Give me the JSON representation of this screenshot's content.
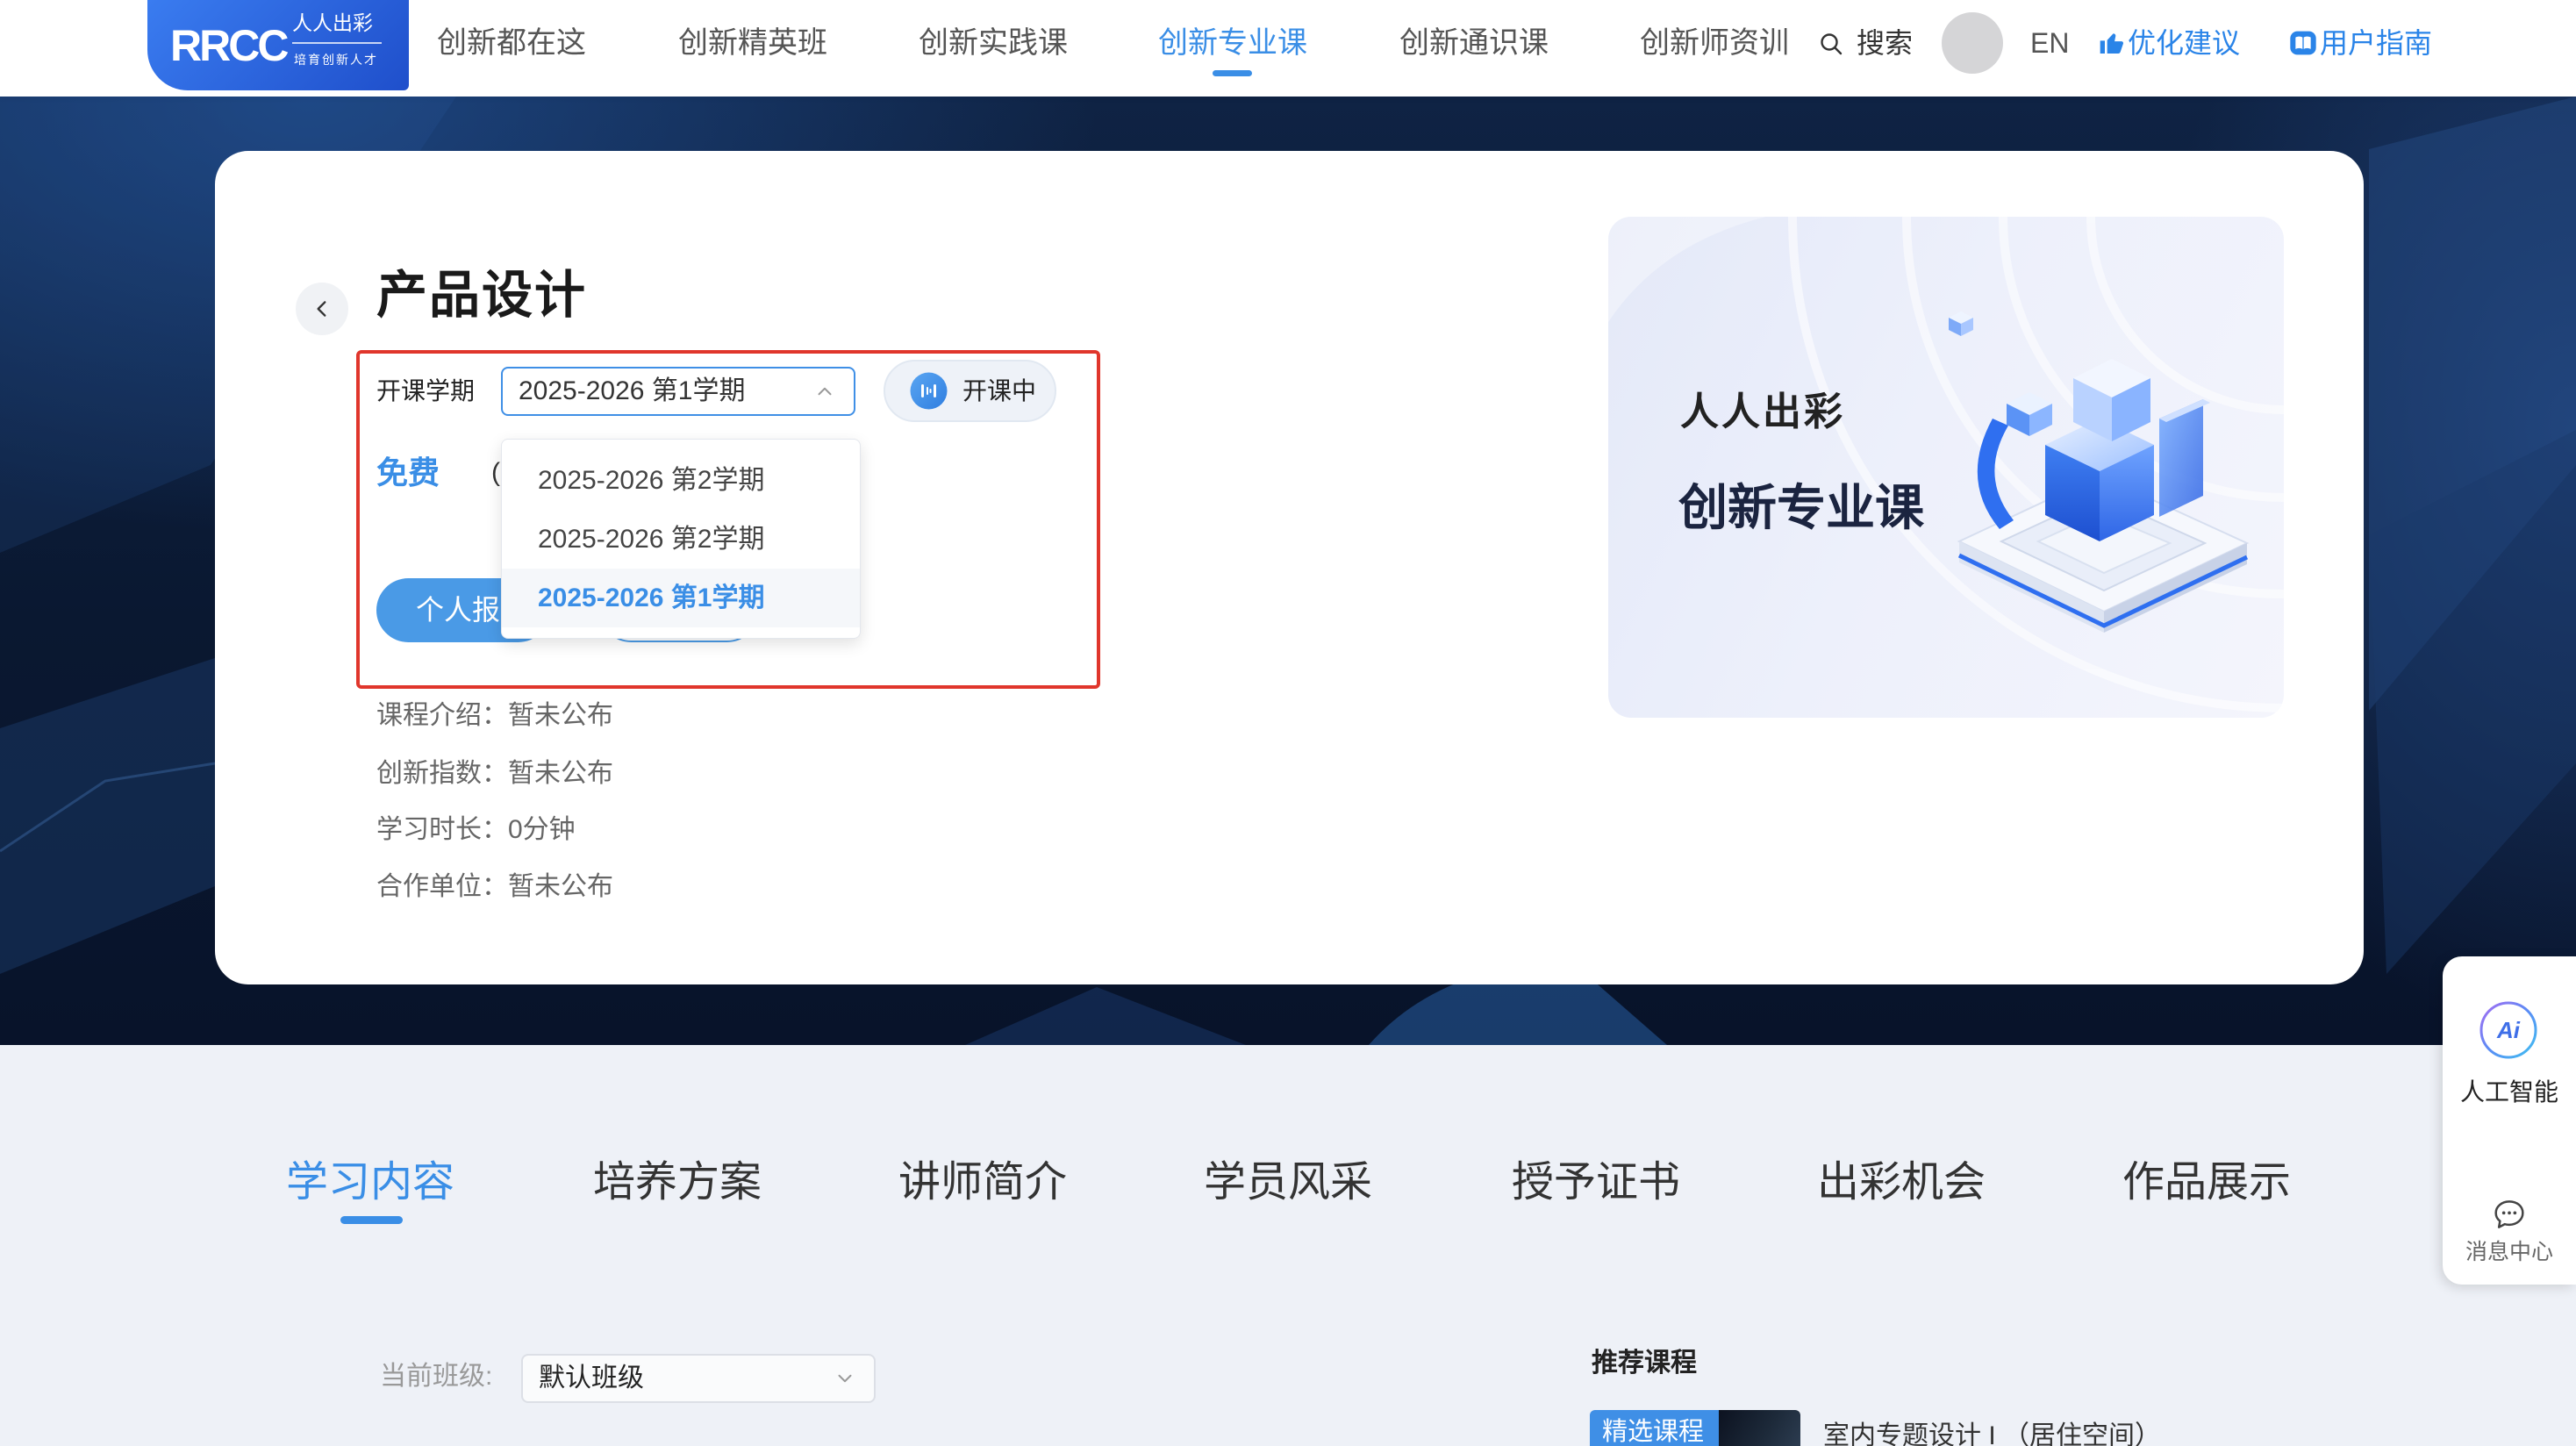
{
  "logo": {
    "brand": "RRCC",
    "name": "人人出彩",
    "slogan": "培育创新人才"
  },
  "nav": {
    "items": [
      "创新都在这",
      "创新精英班",
      "创新实践课",
      "创新专业课",
      "创新通识课",
      "创新师资训"
    ],
    "active_index": 3,
    "search_label": "搜索",
    "language": "EN",
    "feedback_label": "优化建议",
    "guide_label": "用户指南"
  },
  "course": {
    "title": "产品设计",
    "term_label": "开课学期",
    "term_value": "2025-2026 第1学期",
    "term_dropdown_open": true,
    "term_options": [
      "2025-2026 第2学期",
      "2025-2026 第2学期",
      "2025-2026 第1学期"
    ],
    "selected_option_index": 2,
    "status": "开课中",
    "price": "免费",
    "price_note": "(",
    "enroll_label": "个人报",
    "info": [
      {
        "label": "课程介绍：",
        "value": "暂未公布"
      },
      {
        "label": "创新指数：",
        "value": "暂未公布"
      },
      {
        "label": "学习时长：",
        "value": "0分钟"
      },
      {
        "label": "合作单位：",
        "value": "暂未公布"
      }
    ]
  },
  "banner": {
    "line1": "人人出彩",
    "line2": "创新专业课"
  },
  "side_panel": {
    "ai_icon_text": "Ai",
    "ai_label": "人工智能",
    "message_label": "消息中心"
  },
  "tabs": {
    "items": [
      "学习内容",
      "培养方案",
      "讲师简介",
      "学员风采",
      "授予证书",
      "出彩机会",
      "作品展示"
    ],
    "active_index": 0
  },
  "class_select": {
    "label": "当前班级:",
    "value": "默认班级"
  },
  "recommend": {
    "title": "推荐课程",
    "badge": "精选课程",
    "course_name": "室内专题设计 I （居住空间）"
  },
  "colors": {
    "accent": "#3a8ee6",
    "link": "#2a84e8",
    "highlight_box": "#e0362c",
    "hero_background": "#0a1831",
    "lower_background": "#eef1f7"
  },
  "icons": {
    "search": "search-icon",
    "feedback": "thumb-up-icon",
    "guide": "book-icon",
    "back": "chevron-left-icon",
    "term_select": "chevron-up-icon",
    "status": "live-status-icon",
    "ai": "ai-icon",
    "message": "chat-bubble-icon",
    "class_select": "chevron-down-icon"
  }
}
